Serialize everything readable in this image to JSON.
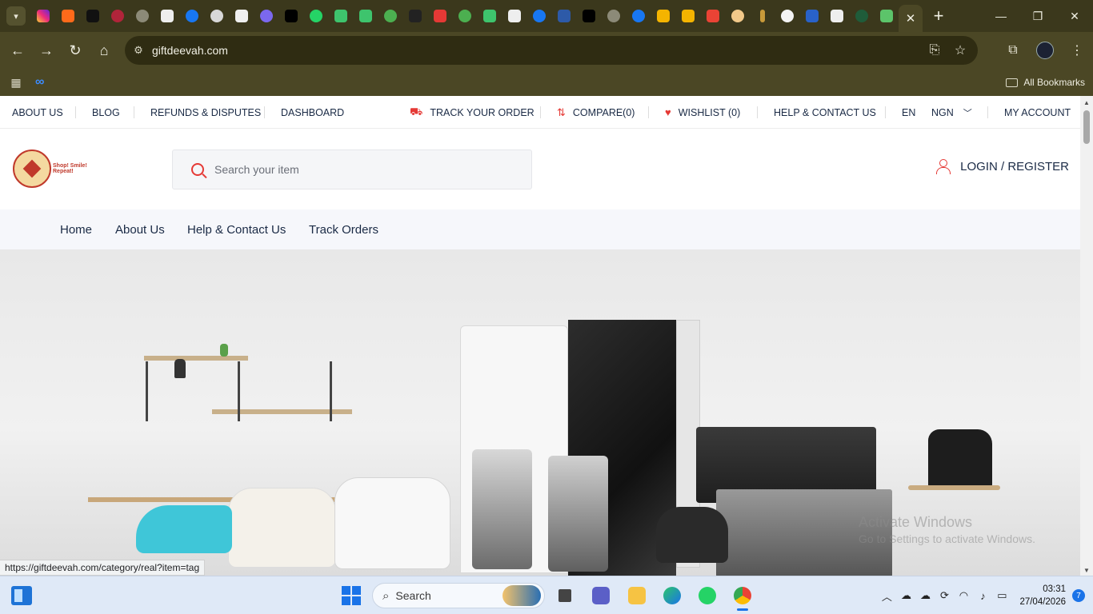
{
  "browser": {
    "url": "giftdeevah.com",
    "bookmarks_all_label": "All Bookmarks",
    "status_url": "https://giftdeevah.com/category/real?item=tag"
  },
  "topnav": {
    "about": "ABOUT US",
    "blog": "BLOG",
    "refunds": "REFUNDS & DISPUTES",
    "dashboard": "DASHBOARD",
    "track": "TRACK YOUR ORDER",
    "compare": "COMPARE(0)",
    "wishlist": "WISHLIST (0)",
    "help": "HELP & CONTACT US",
    "lang": "EN",
    "currency": "NGN",
    "account": "MY ACCOUNT"
  },
  "header": {
    "logo_tagline": "Shop! Smile! Repeat!",
    "search_placeholder": "Search your item",
    "login_label": "LOGIN / REGISTER"
  },
  "mainnav": {
    "home": "Home",
    "about": "About Us",
    "help": "Help & Contact Us",
    "track": "Track Orders"
  },
  "watermark": {
    "line1": "Activate Windows",
    "line2": "Go to Settings to activate Windows."
  },
  "taskbar": {
    "search_label": "Search",
    "time": "03:31",
    "date": "27/04/2026",
    "notifications": "7"
  },
  "colors": {
    "accent_red": "#e53935",
    "nav_text": "#1a2a45",
    "browser_frame": "#3b381c"
  }
}
